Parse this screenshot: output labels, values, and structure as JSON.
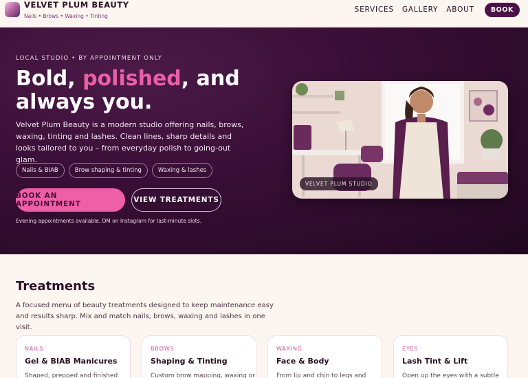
{
  "brand": {
    "name": "VELVET PLUM BEAUTY",
    "tagline": "Nails • Brows • Waxing • Tinting"
  },
  "nav": {
    "items": [
      "SERVICES",
      "GALLERY",
      "ABOUT"
    ],
    "book_label": "BOOK"
  },
  "hero": {
    "eyebrow": "LOCAL STUDIO • BY APPOINTMENT ONLY",
    "headline_pre": "Bold, ",
    "headline_accent": "polished",
    "headline_post": ", and always you.",
    "lead": "Velvet Plum Beauty is a modern studio offering nails, brows, waxing, tinting and lashes. Clean lines, sharp details and looks tailored to you – from everyday polish to going-out glam.",
    "chips": [
      "Nails & BIAB",
      "Brow shaping & tinting",
      "Waxing & lashes"
    ],
    "primary_cta": "BOOK AN APPOINTMENT",
    "secondary_cta": "VIEW TREATMENTS",
    "note": "Evening appointments available. DM on Instagram for last-minute slots.",
    "image_badge": "VELVET PLUM STUDIO"
  },
  "treatments": {
    "title": "Treatments",
    "intro": "A focused menu of beauty treatments designed to keep maintenance easy and results sharp. Mix and match nails, brows, waxing and lashes in one visit.",
    "cards": [
      {
        "kicker": "NAILS",
        "title": "Gel & BIAB Manicures",
        "desc": "Shaped, prepped and finished"
      },
      {
        "kicker": "BROWS",
        "title": "Shaping & Tinting",
        "desc": "Custom brow mapping, waxing or"
      },
      {
        "kicker": "WAXING",
        "title": "Face & Body",
        "desc": "From lip and chin to legs and"
      },
      {
        "kicker": "EYES",
        "title": "Lash Tint & Lift",
        "desc": "Open up the eyes with a subtle"
      }
    ]
  },
  "colors": {
    "brand_plum": "#4a1247",
    "accent_pink": "#ec5fa6",
    "hero_bg": "#3a0f37",
    "page_bg": "#fdf5f0"
  }
}
